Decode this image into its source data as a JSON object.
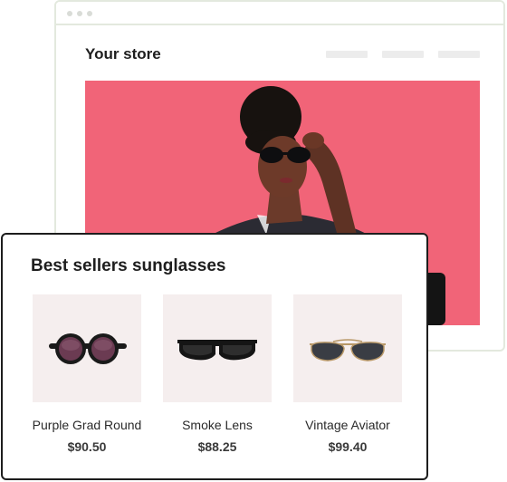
{
  "store": {
    "title": "Your store",
    "nav_items": 3
  },
  "card": {
    "title": "Best sellers sunglasses",
    "products": [
      {
        "name": "Purple Grad Round",
        "price": "$90.50",
        "icon": "round-sunglasses-icon"
      },
      {
        "name": "Smoke Lens",
        "price": "$88.25",
        "icon": "rectangular-sunglasses-icon"
      },
      {
        "name": "Vintage Aviator",
        "price": "$99.40",
        "icon": "aviator-sunglasses-icon"
      }
    ]
  },
  "colors": {
    "hero_background": "#f05a6f",
    "card_border": "#1d1d1d",
    "product_tile": "#f5eeee",
    "window_border": "#e3e9de"
  }
}
